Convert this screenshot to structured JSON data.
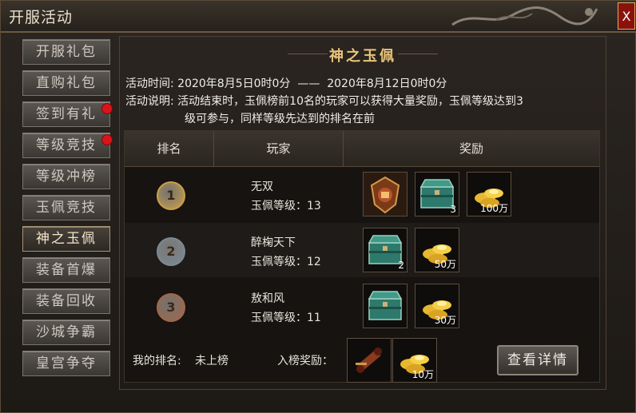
{
  "window": {
    "title": "开服活动",
    "close_glyph": "X"
  },
  "sidebar": {
    "items": [
      {
        "label": "开服礼包",
        "active": false,
        "dot": false
      },
      {
        "label": "直购礼包",
        "active": false,
        "dot": false
      },
      {
        "label": "签到有礼",
        "active": false,
        "dot": true
      },
      {
        "label": "等级竞技",
        "active": false,
        "dot": true
      },
      {
        "label": "等级冲榜",
        "active": false,
        "dot": false
      },
      {
        "label": "玉佩竞技",
        "active": false,
        "dot": false
      },
      {
        "label": "神之玉佩",
        "active": true,
        "dot": false
      },
      {
        "label": "装备首爆",
        "active": false,
        "dot": false
      },
      {
        "label": "装备回收",
        "active": false,
        "dot": false
      },
      {
        "label": "沙城争霸",
        "active": false,
        "dot": false
      },
      {
        "label": "皇宫争夺",
        "active": false,
        "dot": false
      }
    ]
  },
  "activity": {
    "title": "神之玉佩",
    "time_label": "活动时间:",
    "time_value": "2020年8月5日0时0分  ——  2020年8月12日0时0分",
    "desc_label": "活动说明:",
    "desc_line1": "活动结束时，玉佩榜前10名的玩家可以获得大量奖励，玉佩等级达到3",
    "desc_line2": "级可参与，同样等级先达到的排名在前"
  },
  "table": {
    "headers": {
      "rank": "排名",
      "player": "玩家",
      "reward": "奖励"
    },
    "rows": [
      {
        "rank": "1",
        "name": "无双",
        "level": "玉佩等级：13",
        "rewards": [
          {
            "icon": "shield-item-icon",
            "qty": ""
          },
          {
            "icon": "jade-chest-icon",
            "qty": "3"
          },
          {
            "icon": "gold-ingot-icon",
            "qty": "100万"
          }
        ]
      },
      {
        "rank": "2",
        "name": "醉椈天下",
        "level": "玉佩等级：12",
        "rewards": [
          {
            "icon": "jade-chest-icon",
            "qty": "2"
          },
          {
            "icon": "gold-ingot-icon",
            "qty": "50万"
          }
        ]
      },
      {
        "rank": "3",
        "name": "敖和风",
        "level": "玉佩等级：11",
        "rewards": [
          {
            "icon": "jade-chest-icon",
            "qty": ""
          },
          {
            "icon": "gold-ingot-icon",
            "qty": "30万"
          }
        ]
      }
    ]
  },
  "footer": {
    "my_rank_label": "我的排名:",
    "my_rank_value": "未上榜",
    "entry_reward_label": "入榜奖励：",
    "entry_rewards": [
      {
        "icon": "scroll-item-icon",
        "qty": ""
      },
      {
        "icon": "gold-ingot-icon",
        "qty": "10万"
      }
    ],
    "detail_button": "查看详情"
  },
  "colors": {
    "gold": "#e9c47a",
    "medal_gold": "#c9a04a",
    "medal_silver": "#7d8a94",
    "medal_bronze": "#a0684a",
    "red_dot": "#d8141a"
  }
}
